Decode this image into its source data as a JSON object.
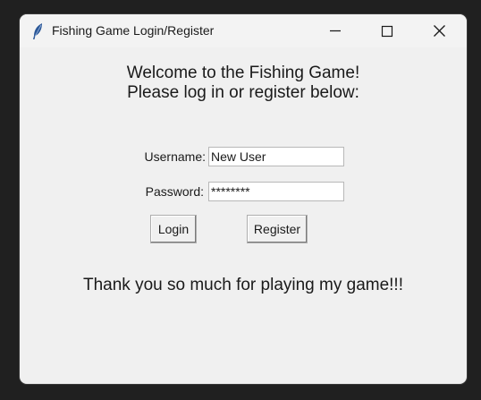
{
  "window": {
    "title": "Fishing Game Login/Register",
    "icon": "feather-icon",
    "controls": [
      "minimize-icon",
      "maximize-icon",
      "close-icon"
    ]
  },
  "welcome": {
    "line1": "Welcome to the Fishing Game!",
    "line2": "Please log in or register below:"
  },
  "form": {
    "username_label": "Username:",
    "username_value": "New User",
    "password_label": "Password:",
    "password_value": "********"
  },
  "buttons": {
    "login": "Login",
    "register": "Register"
  },
  "footer": {
    "thanks": "Thank you so much for playing my game!!!"
  },
  "colors": {
    "window_bg": "#f0f0f0",
    "desktop_bg": "#202020",
    "text": "#1a1a1a"
  }
}
